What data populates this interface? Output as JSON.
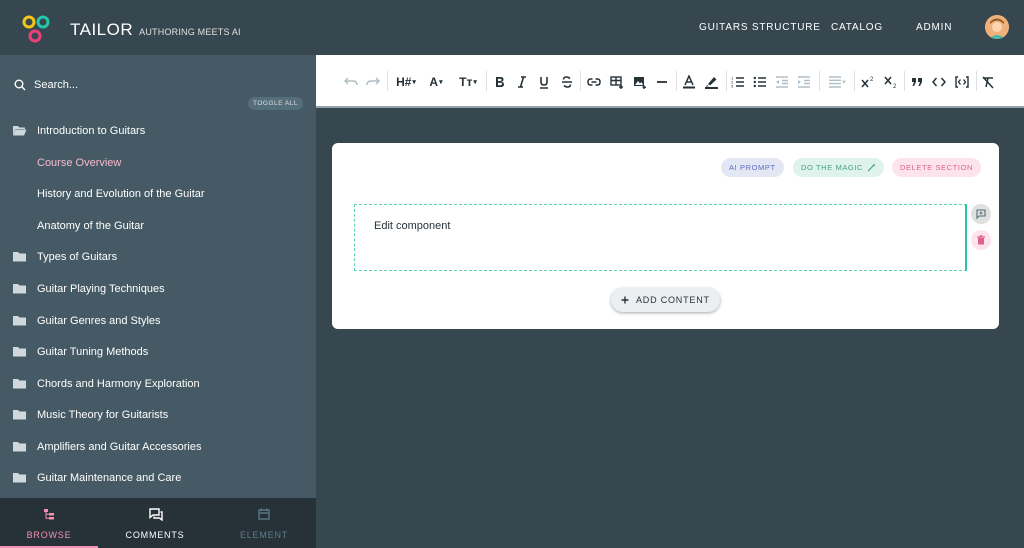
{
  "header": {
    "brand": "TAILOR",
    "tagline": "AUTHORING MEETS AI",
    "nav": [
      "GUITARS STRUCTURE",
      "CATALOG",
      "ADMIN"
    ]
  },
  "sidebar": {
    "search_placeholder": "Search...",
    "toggle_all": "TOGGLE ALL",
    "items": [
      {
        "label": "Introduction to Guitars",
        "icon": "folder-open-icon",
        "level": 0
      },
      {
        "label": "Course Overview",
        "icon": null,
        "level": 1,
        "active": true
      },
      {
        "label": "History and Evolution of the Guitar",
        "icon": null,
        "level": 1
      },
      {
        "label": "Anatomy of the Guitar",
        "icon": null,
        "level": 1
      },
      {
        "label": "Types of Guitars",
        "icon": "folder-icon",
        "level": 0
      },
      {
        "label": "Guitar Playing Techniques",
        "icon": "folder-icon",
        "level": 0
      },
      {
        "label": "Guitar Genres and Styles",
        "icon": "folder-icon",
        "level": 0
      },
      {
        "label": "Guitar Tuning Methods",
        "icon": "folder-icon",
        "level": 0
      },
      {
        "label": "Chords and Harmony Exploration",
        "icon": "folder-icon",
        "level": 0
      },
      {
        "label": "Music Theory for Guitarists",
        "icon": "folder-icon",
        "level": 0
      },
      {
        "label": "Amplifiers and Guitar Accessories",
        "icon": "folder-icon",
        "level": 0
      },
      {
        "label": "Guitar Maintenance and Care",
        "icon": "folder-icon",
        "level": 0
      }
    ],
    "tabs": [
      {
        "label": "BROWSE",
        "icon": "tree-icon",
        "active": true
      },
      {
        "label": "COMMENTS",
        "icon": "comments-icon"
      },
      {
        "label": "ELEMENT",
        "icon": "calendar-icon",
        "disabled": true
      }
    ]
  },
  "toolbar": {
    "heading": "H#",
    "font_size": "A",
    "text_style": "Tт"
  },
  "section": {
    "ai_prompt": "AI PROMPT",
    "do_magic": "DO THE MAGIC",
    "delete_section": "DELETE SECTION",
    "component_text": "Edit component",
    "add_content": "ADD CONTENT"
  },
  "colors": {
    "background": "#37474f",
    "sidebar": "#455a64",
    "active_item": "#f8bbd0",
    "accent_teal": "#2bc4a3",
    "accent_pink": "#f48fb1"
  }
}
